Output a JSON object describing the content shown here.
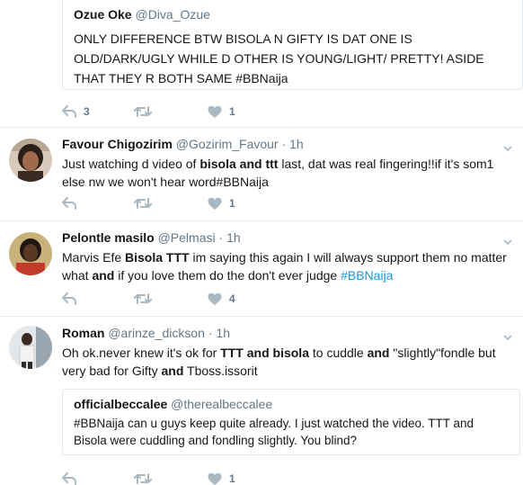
{
  "tweets": [
    {
      "name": "Ozue Oke",
      "handle": "@Diva_Ozue",
      "line1": "ONLY DIFFERENCE BTW BISOLA N GIFTY IS DAT ONE IS",
      "line2": "OLD/DARK/UGLY WHILE D OTHER IS YOUNG/LIGHT/ PRETTY! ASIDE",
      "line3": "THAT THEY R BOTH SAME #BBNaija",
      "reply_count": "3",
      "like_count": "1"
    },
    {
      "name": "Favour Chigozirim",
      "handle": "@Gozirim_Favour",
      "dot": "·",
      "time": "1h",
      "text": {
        "a": "Just watching d video of ",
        "b1": "bisola",
        "c": " ",
        "b2": "and",
        "d": " ",
        "b3": "ttt",
        "e": " last, dat was real fingering!!if it's som1",
        "f": "else nw we won't hear word#BBNaija"
      },
      "like_count": "1"
    },
    {
      "name": "Pelontle masilo",
      "handle": "@Pelmasi",
      "dot": "·",
      "time": "1h",
      "text": {
        "a": "Marvis Efe ",
        "b1": "Bisola TTT",
        "c": " im saying this again I will always support them no matter",
        "d": "what ",
        "b2": "and",
        "e": " if you love them do the don't ever judge ",
        "tag": "#BBNaija"
      },
      "like_count": "4"
    },
    {
      "name": "Roman",
      "handle": "@arinze_dickson",
      "dot": "·",
      "time": "1h",
      "text": {
        "a": "Oh ok.never knew it's ok for ",
        "b1": "TTT and bisola",
        "c": " to cuddle ",
        "b2": "and",
        "d": " \"slightly\"fondle but",
        "e": "very bad for Gifty ",
        "b3": "and",
        "f": " Tboss.issorit"
      },
      "quote": {
        "name": "officialbeccalee",
        "handle": "@therealbeccalee",
        "line1": "#BBNaija can u guys keep quite already. I just watched the video. TTT and",
        "line2": "Bisola were cuddling and fondling slightly. You blind?"
      },
      "like_count": "1"
    }
  ],
  "icons": {
    "reply": "reply-icon",
    "retweet": "retweet-icon",
    "like": "heart-icon",
    "caret": "chevron-down-icon"
  },
  "colors": {
    "link": "#1b95e0",
    "action_gray": "#aab8c2",
    "secondary_text": "#657786",
    "border": "#e6ecf0"
  }
}
